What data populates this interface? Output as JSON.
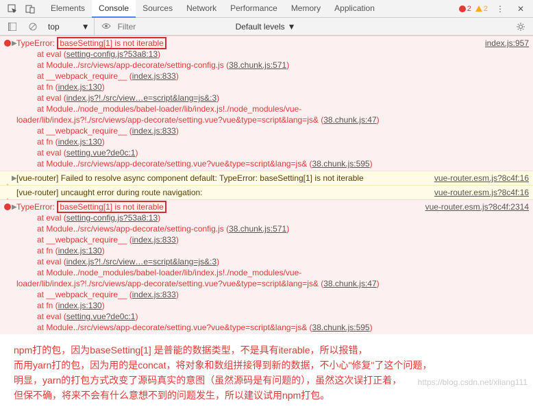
{
  "toolbar": {
    "tabs": [
      "Elements",
      "Console",
      "Sources",
      "Network",
      "Performance",
      "Memory",
      "Application"
    ],
    "active_tab": "Console",
    "error_count": "2",
    "warn_count": "2"
  },
  "filterbar": {
    "context": "top",
    "filter_placeholder": "Filter",
    "levels_label": "Default levels"
  },
  "messages": {
    "err1": {
      "prefix": "TypeError:",
      "highlight": "baseSetting[1] is not iterable",
      "src": "index.js:957",
      "stack": [
        {
          "t": "at eval (",
          "l": "setting-config.js?53a8:13",
          "r": ")",
          "right": ""
        },
        {
          "t": "at Module../src/views/app-decorate/setting-config.js (",
          "l": "38.chunk.js:571",
          "r": ")",
          "right": ""
        },
        {
          "t": "at __webpack_require__ (",
          "l": "index.js:833",
          "r": ")",
          "right": ""
        },
        {
          "t": "at fn (",
          "l": "index.js:130",
          "r": ")",
          "right": ""
        },
        {
          "t": "at eval (",
          "l": "index.js?!./src/view…e=script&lang=js&:3",
          "r": ")",
          "right": ""
        },
        {
          "t": "at Module../node_modules/babel-loader/lib/index.js!./node_modules/vue-",
          "l": "",
          "r": "",
          "right": ""
        },
        {
          "t": "loader/lib/index.js?!./src/views/app-decorate/setting.vue?vue&type=script&lang=js& (",
          "l": "38.chunk.js:47",
          "r": ")",
          "right": "",
          "indent": "-30"
        },
        {
          "t": "at __webpack_require__ (",
          "l": "index.js:833",
          "r": ")",
          "right": ""
        },
        {
          "t": "at fn (",
          "l": "index.js:130",
          "r": ")",
          "right": ""
        },
        {
          "t": "at eval (",
          "l": "setting.vue?de0c:1",
          "r": ")",
          "right": ""
        },
        {
          "t": "at Module../src/views/app-decorate/setting.vue?vue&type=script&lang=js& (",
          "l": "38.chunk.js:595",
          "r": ")",
          "right": ""
        }
      ]
    },
    "warn1": {
      "text": "[vue-router] Failed to resolve async component default: TypeError: baseSetting[1] is not iterable",
      "src": "vue-router.esm.js?8c4f:16"
    },
    "warn2": {
      "text": "[vue-router] uncaught error during route navigation:",
      "src": "vue-router.esm.js?8c4f:16"
    },
    "err2": {
      "prefix": "TypeError:",
      "highlight": "baseSetting[1] is not iterable",
      "src": "vue-router.esm.js?8c4f:2314",
      "stack": [
        {
          "t": "at eval (",
          "l": "setting-config.js?53a8:13",
          "r": ")"
        },
        {
          "t": "at Module../src/views/app-decorate/setting-config.js (",
          "l": "38.chunk.js:571",
          "r": ")"
        },
        {
          "t": "at __webpack_require__ (",
          "l": "index.js:833",
          "r": ")"
        },
        {
          "t": "at fn (",
          "l": "index.js:130",
          "r": ")"
        },
        {
          "t": "at eval (",
          "l": "index.js?!./src/view…e=script&lang=js&:3",
          "r": ")"
        },
        {
          "t": "at Module../node_modules/babel-loader/lib/index.js!./node_modules/vue-",
          "l": "",
          "r": ""
        },
        {
          "t": "loader/lib/index.js?!./src/views/app-decorate/setting.vue?vue&type=script&lang=js& (",
          "l": "38.chunk.js:47",
          "r": ")",
          "indent": "-30"
        },
        {
          "t": "at __webpack_require__ (",
          "l": "index.js:833",
          "r": ")"
        },
        {
          "t": "at fn (",
          "l": "index.js:130",
          "r": ")"
        },
        {
          "t": "at eval (",
          "l": "setting.vue?de0c:1",
          "r": ")"
        },
        {
          "t": "at Module../src/views/app-decorate/setting.vue?vue&type=script&lang=js& (",
          "l": "38.chunk.js:595",
          "r": ")"
        }
      ]
    }
  },
  "annotation": {
    "l1": "npm打的包，因为baseSetting[1] 是普能的数据类型，不是具有iterable，所以报错，",
    "l2": "而用yarn打的包，因为用的是concat，将对象和数组拼接得到新的数据，不小心\"修复\"了这个问题，",
    "l3": "明显，yarn的打包方式改变了源码真实的意图（虽然源码是有问题的），虽然这次误打正着，",
    "l4": "但保不确，将来不会有什么意想不到的问题发生，所以建议试用npm打包。"
  },
  "watermark": "https://blog.csdn.net/xliang111"
}
